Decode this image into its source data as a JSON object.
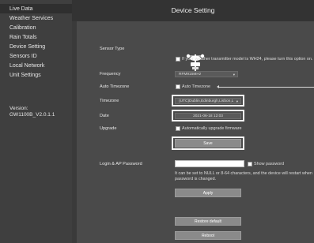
{
  "sidebar": {
    "items": [
      {
        "label": "Live Data"
      },
      {
        "label": "Weather Services"
      },
      {
        "label": "Calibration"
      },
      {
        "label": "Rain Totals"
      },
      {
        "label": "Device Setting"
      },
      {
        "label": "Sensors ID"
      },
      {
        "label": "Local Network"
      },
      {
        "label": "Unit Settings"
      }
    ],
    "version_label": "Version:",
    "version_value": "GW1100B_V2.0.1.1"
  },
  "header": {
    "title": "Device Setting"
  },
  "form": {
    "sensor_type_label": "Sensor Type",
    "sensor_icon": "weather-station-icon",
    "wh24_note": "If your weather transmitter model is WH24, please turn this option on.",
    "frequency_label": "Frequency",
    "frequency_value": "RFM915MHz",
    "auto_timezone_label": "Auto Timezone",
    "auto_timezone_checkbox_label": "Auto Timezone",
    "timezone_label": "Timezone",
    "timezone_value": "(UTC)Dublin,Edinburgh,Lisbon,L",
    "date_label": "Date",
    "date_value": "2021-06-18 12:03",
    "upgrade_label": "Upgrade",
    "upgrade_checkbox_label": "Automatically upgrade firmware",
    "save_button": "Save",
    "login_label": "Login & AP Password",
    "show_password_label": "Show password",
    "password_note_line1": "It can be set to NULL or 8-64 characters, and the device will restart when",
    "password_note_line2": "password is changed.",
    "apply_button": "Apply",
    "restore_button": "Restore default",
    "reboot_button": "Reboot"
  },
  "colors": {
    "sidebar_bg": "#3f3f3f",
    "header_bg": "#333333",
    "content_bg": "#4a4a4a",
    "button_bg": "#8a8a8a"
  }
}
